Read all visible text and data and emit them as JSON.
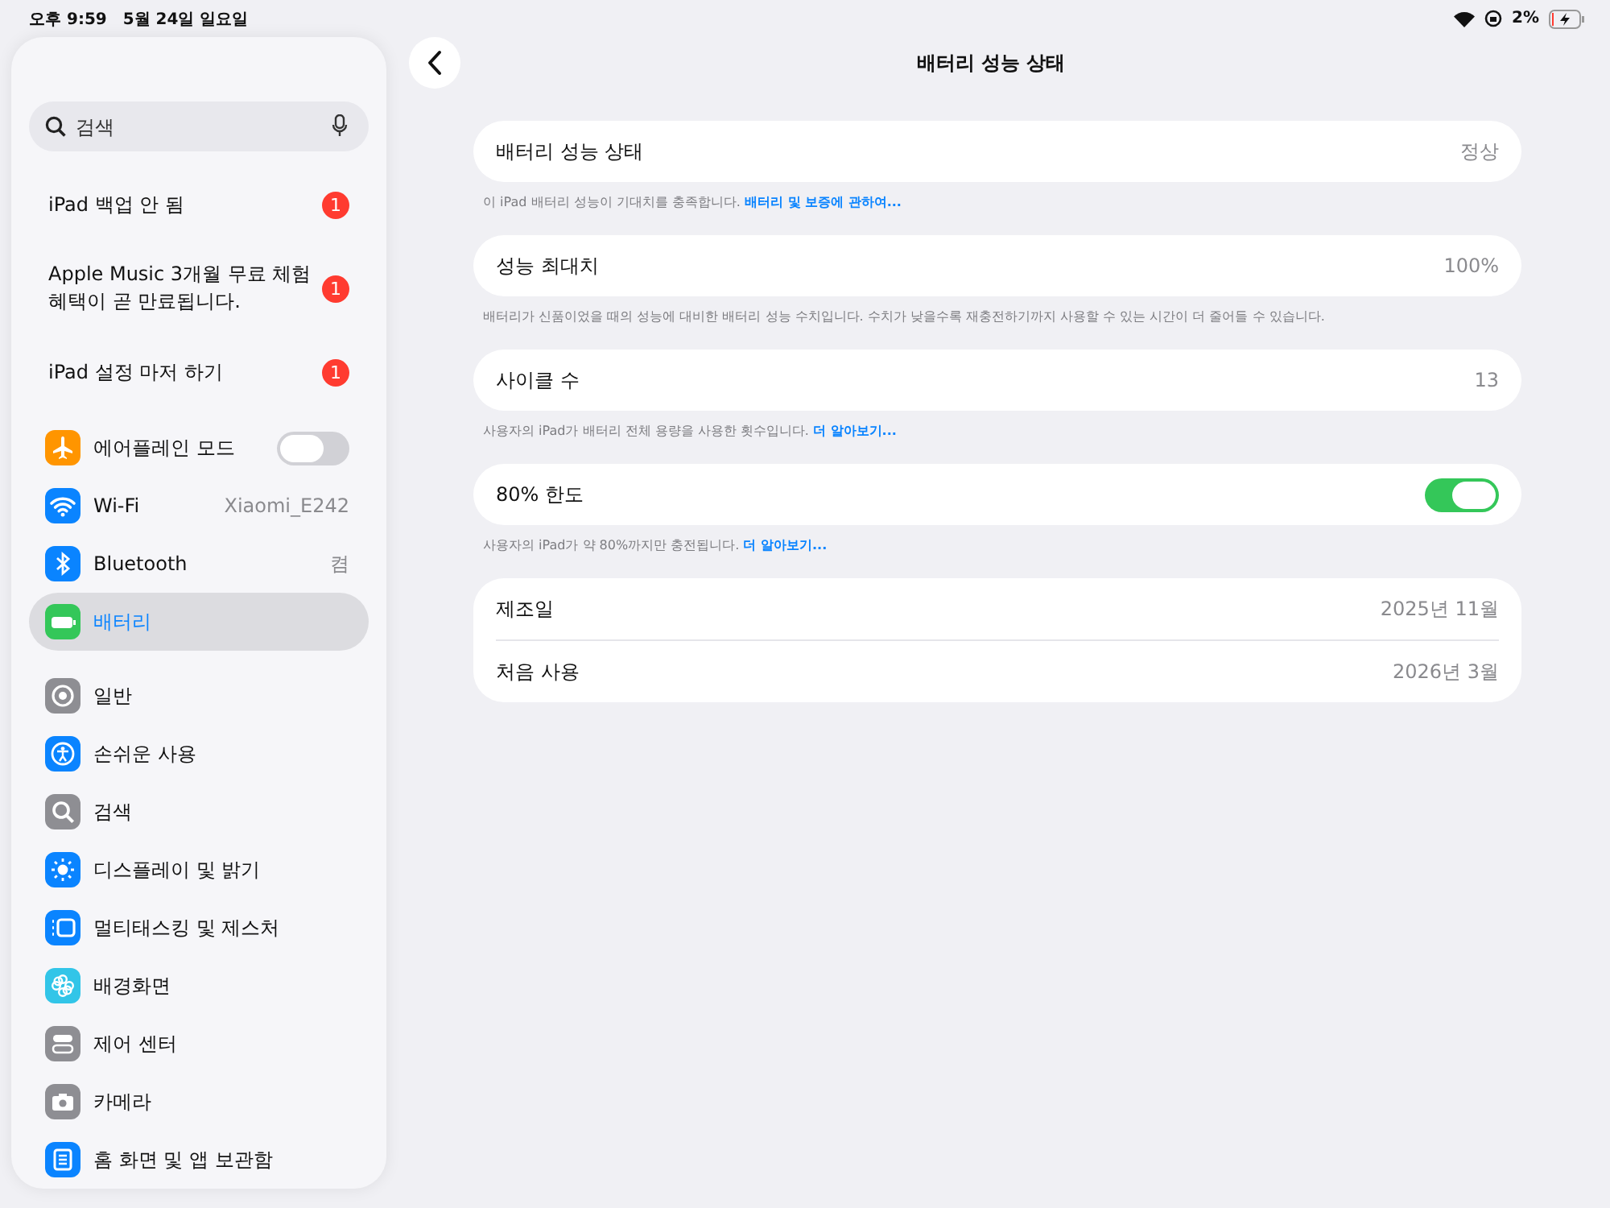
{
  "status_bar": {
    "time": "오후 9:59",
    "date": "5월 24일 일요일",
    "battery": "2%"
  },
  "sidebar": {
    "search": {
      "placeholder": "검색"
    },
    "alerts": [
      {
        "label": "iPad 백업 안 됨",
        "badge": "1"
      },
      {
        "label": "Apple Music 3개월 무료 체험 혜택이 곧 만료됩니다.",
        "badge": "1"
      },
      {
        "label": "iPad 설정 마저 하기",
        "badge": "1"
      }
    ],
    "groups": [
      [
        {
          "label": "에어플레인 모드",
          "kind": "toggle",
          "on": false,
          "selected": false,
          "color": "#ff9500"
        },
        {
          "label": "Wi-Fi",
          "kind": "value",
          "value": "Xiaomi_E242",
          "selected": false,
          "color": "#0a84ff"
        },
        {
          "label": "Bluetooth",
          "kind": "value",
          "value": "켬",
          "selected": false,
          "color": "#0a84ff"
        },
        {
          "label": "배터리",
          "kind": "link",
          "selected": true,
          "color": "#34c759"
        }
      ],
      [
        {
          "label": "일반",
          "kind": "link",
          "selected": false,
          "color": "#8e8e93"
        },
        {
          "label": "손쉬운 사용",
          "kind": "link",
          "selected": false,
          "color": "#0a84ff"
        },
        {
          "label": "검색",
          "kind": "link",
          "selected": false,
          "color": "#8e8e93"
        },
        {
          "label": "디스플레이 및 밝기",
          "kind": "link",
          "selected": false,
          "color": "#0a84ff"
        },
        {
          "label": "멀티태스킹 및 제스처",
          "kind": "link",
          "selected": false,
          "color": "#0a84ff"
        },
        {
          "label": "배경화면",
          "kind": "link",
          "selected": false,
          "color": "#32c5e8"
        },
        {
          "label": "제어 센터",
          "kind": "link",
          "selected": false,
          "color": "#8e8e93"
        },
        {
          "label": "카메라",
          "kind": "link",
          "selected": false,
          "color": "#8e8e93"
        },
        {
          "label": "홈 화면 및 앱 보관함",
          "kind": "link",
          "selected": false,
          "color": "#0a84ff"
        }
      ]
    ]
  },
  "main": {
    "title": "배터리 성능 상태",
    "groups": [
      {
        "rows": [
          {
            "label": "배터리 성능 상태",
            "kind": "value",
            "value": "정상"
          }
        ],
        "footer": "이 iPad 배터리 성능이 기대치를 충족합니다.",
        "footer_link": "배터리 및 보증에 관하여..."
      },
      {
        "rows": [
          {
            "label": "성능 최대치",
            "kind": "value",
            "value": "100%"
          }
        ],
        "footer": "배터리가 신품이었을 때의 성능에 대비한 배터리 성능 수치입니다. 수치가 낮을수록 재충전하기까지 사용할 수 있는 시간이 더 줄어들 수 있습니다."
      },
      {
        "rows": [
          {
            "label": "사이클 수",
            "kind": "value",
            "value": "13"
          }
        ],
        "footer": "사용자의 iPad가 배터리 전체 용량을 사용한 횟수입니다.",
        "footer_link": "더 알아보기..."
      },
      {
        "rows": [
          {
            "label": "80% 한도",
            "kind": "toggle",
            "on": true
          }
        ],
        "footer": "사용자의 iPad가 약 80%까지만 충전됩니다.",
        "footer_link": "더 알아보기..."
      },
      {
        "rows": [
          {
            "label": "제조일",
            "kind": "value",
            "value": "2025년 11월"
          },
          {
            "label": "처음 사용",
            "kind": "value",
            "value": "2026년 3월"
          }
        ]
      }
    ]
  }
}
